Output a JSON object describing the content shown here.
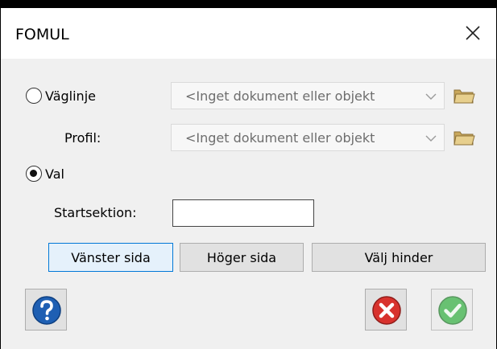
{
  "window": {
    "title": "FOMUL"
  },
  "vaglinje": {
    "label": "Väglinje",
    "selected": false,
    "combo_text": "<Inget dokument eller objekt"
  },
  "profil": {
    "label": "Profil:",
    "combo_text": "<Inget dokument eller objekt"
  },
  "val": {
    "label": "Val",
    "selected": true
  },
  "startsektion": {
    "label": "Startsektion:",
    "value": ""
  },
  "buttons": {
    "vanster": "Vänster sida",
    "hoger": "Höger sida",
    "valj_hinder": "Välj hinder"
  },
  "icons": {
    "close": "close-icon",
    "chevron": "chevron-down-icon",
    "folder": "folder-icon",
    "help": "help-icon",
    "cancel": "cancel-icon",
    "ok": "ok-check-icon"
  },
  "colors": {
    "dialog_bg": "#f0f0f0",
    "button_bg": "#e1e1e1",
    "selected_button_border": "#0078d7",
    "help_blue": "#1e5fb3",
    "cancel_red": "#d8322d",
    "ok_green": "#3db34a"
  }
}
